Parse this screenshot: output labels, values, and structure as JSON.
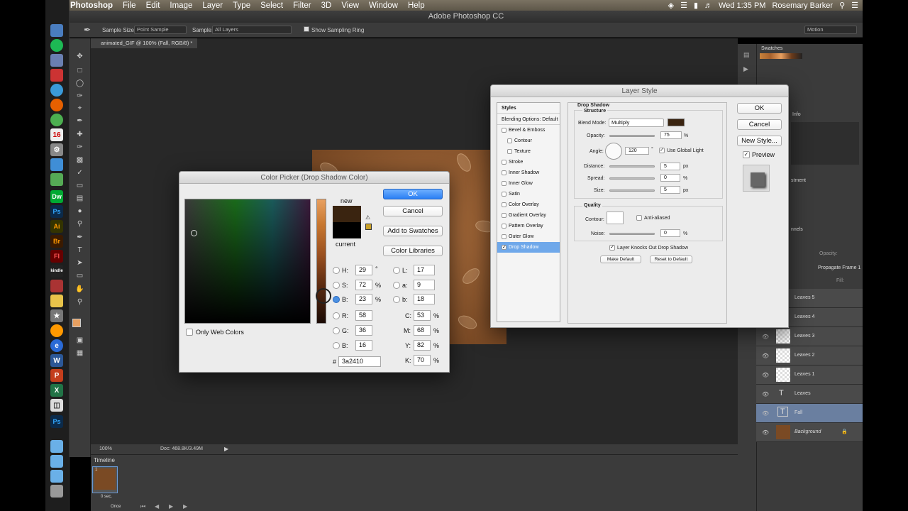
{
  "menubar": {
    "app": "Photoshop",
    "items": [
      "File",
      "Edit",
      "Image",
      "Layer",
      "Type",
      "Select",
      "Filter",
      "3D",
      "View",
      "Window",
      "Help"
    ],
    "clock": "Wed 1:35 PM",
    "user": "Rosemary Barker"
  },
  "window": {
    "title": "Adobe Photoshop CC"
  },
  "options": {
    "sample_size_label": "Sample Size:",
    "sample_size_value": "Point Sample",
    "sample_label": "Sample:",
    "sample_value": "All Layers",
    "show_ring": "Show Sampling Ring",
    "workspace": "Motion"
  },
  "document": {
    "tab": "animated_GIF @ 100% (Fall, RGB/8) *",
    "zoom": "100%",
    "doc_size": "Doc: 468.8K/3.49M"
  },
  "timeline": {
    "title": "Timeline",
    "frame_number": "1",
    "frame_delay": "0 sec.",
    "loop": "Once"
  },
  "color_picker": {
    "title": "Color Picker (Drop Shadow Color)",
    "ok": "OK",
    "cancel": "Cancel",
    "add_swatches": "Add to Swatches",
    "color_libraries": "Color Libraries",
    "new_label": "new",
    "current_label": "current",
    "only_web": "Only Web Colors",
    "new_color": "#3a2410",
    "current_color": "#000000",
    "fields": {
      "H": "29",
      "S": "72",
      "B": "23",
      "R": "58",
      "G": "36",
      "Bl": "16",
      "L": "17",
      "a": "9",
      "b": "18",
      "C": "53",
      "M": "68",
      "Y": "82",
      "K": "70"
    },
    "labels": {
      "H": "H:",
      "S": "S:",
      "B": "B:",
      "R": "R:",
      "G": "G:",
      "Bl": "B:",
      "L": "L:",
      "a": "a:",
      "b": "b:",
      "C": "C:",
      "M": "M:",
      "Y": "Y:",
      "K": "K:"
    },
    "units": {
      "deg": "°",
      "pct": "%"
    },
    "hex_label": "#",
    "hex": "3a2410"
  },
  "layer_style": {
    "title": "Layer Style",
    "styles_header": "Styles",
    "items": [
      "Blending Options: Default",
      "Bevel & Emboss",
      "Contour",
      "Texture",
      "Stroke",
      "Inner Shadow",
      "Inner Glow",
      "Satin",
      "Color Overlay",
      "Gradient Overlay",
      "Pattern Overlay",
      "Outer Glow",
      "Drop Shadow"
    ],
    "section": "Drop Shadow",
    "structure": "Structure",
    "blend_mode_label": "Blend Mode:",
    "blend_mode": "Multiply",
    "opacity_label": "Opacity:",
    "opacity": "75",
    "angle_label": "Angle:",
    "angle": "120",
    "global_light": "Use Global Light",
    "distance_label": "Distance:",
    "distance": "5",
    "spread_label": "Spread:",
    "spread": "0",
    "size_label": "Size:",
    "size": "5",
    "px": "px",
    "pct": "%",
    "deg": "°",
    "quality": "Quality",
    "contour_label": "Contour:",
    "anti_aliased": "Anti-aliased",
    "noise_label": "Noise:",
    "noise": "0",
    "knockout": "Layer Knocks Out Drop Shadow",
    "make_default": "Make Default",
    "reset_default": "Reset to Default",
    "ok": "OK",
    "cancel": "Cancel",
    "new_style": "New Style...",
    "preview": "Preview",
    "shadow_color": "#3a2410"
  },
  "panels": {
    "swatches": "Swatches",
    "info": "Info",
    "adjustments": "stment",
    "layers_tab": "nnels",
    "opacity": "Opacity:",
    "fill": "Fill:",
    "propagate": "Propagate Frame 1"
  },
  "layers": [
    "Leaves 5",
    "Leaves 4",
    "Leaves 3",
    "Leaves 2",
    "Leaves 1",
    "Leaves",
    "Fall",
    "Background"
  ]
}
